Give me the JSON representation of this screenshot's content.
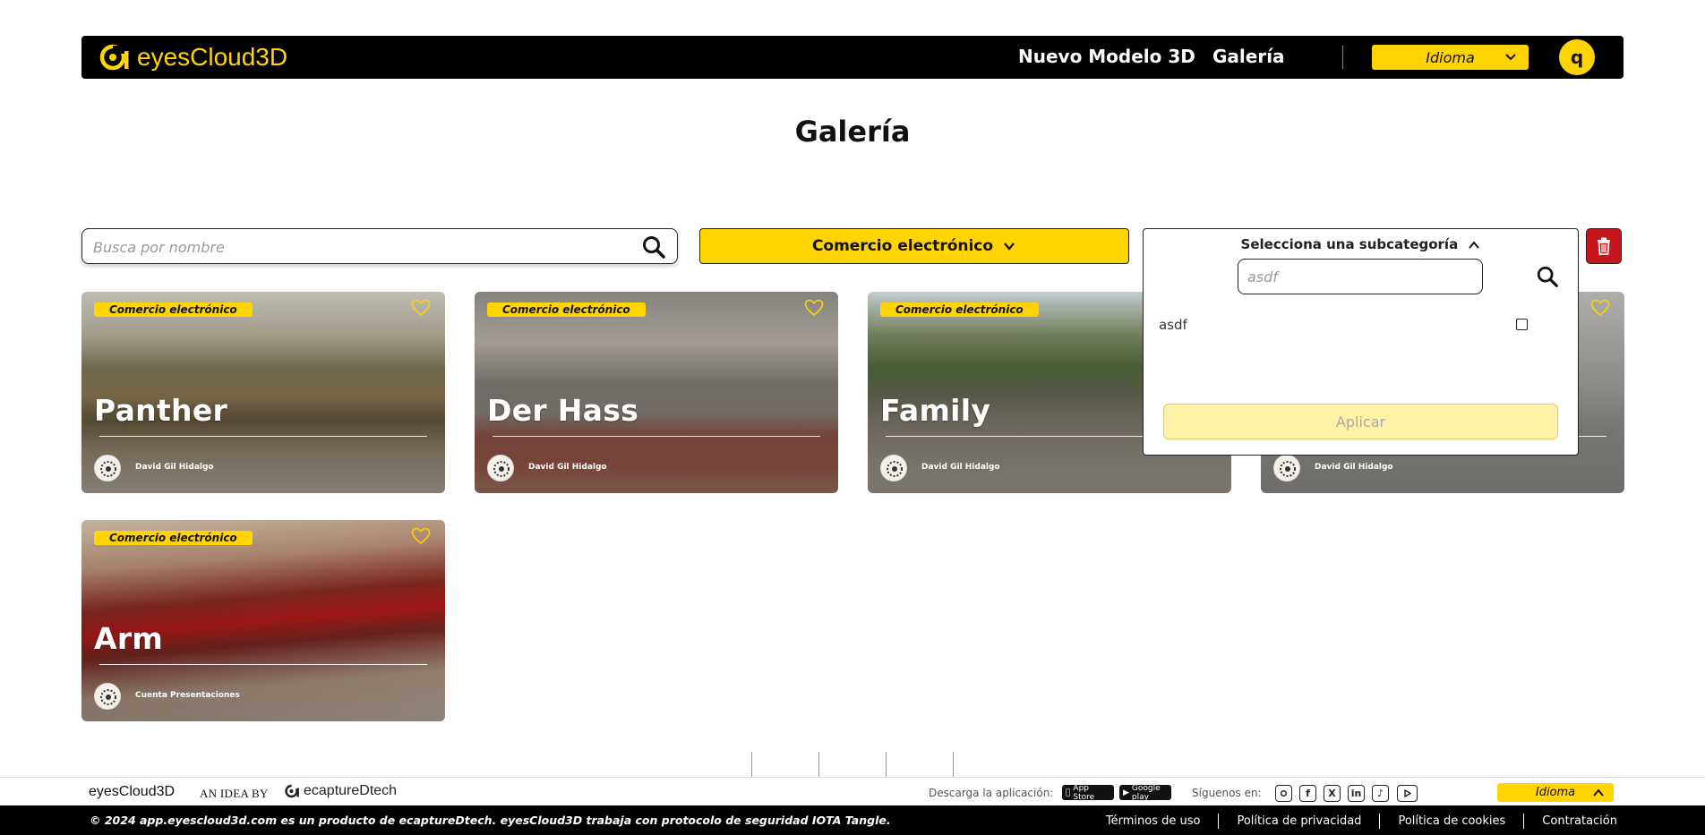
{
  "header": {
    "logo_text": "eyesCloud3D",
    "nav": {
      "new_model": "Nuevo Modelo 3D",
      "gallery": "Galería"
    },
    "language_label": "Idioma",
    "avatar_initial": "q"
  },
  "page_title": "Galería",
  "filters": {
    "search_placeholder": "Busca por nombre",
    "category_label": "Comercio electrónico",
    "subcategory": {
      "header": "Selecciona una subcategoría",
      "search_value": "asdf",
      "option_label": "asdf",
      "apply_label": "Aplicar"
    }
  },
  "cards": [
    {
      "badge": "Comercio electrónico",
      "title": "Panther",
      "author": "David Gil Hidalgo"
    },
    {
      "badge": "Comercio electrónico",
      "title": "Der Hass",
      "author": "David Gil Hidalgo"
    },
    {
      "badge": "Comercio electrónico",
      "title": "Family",
      "author": "David Gil Hidalgo"
    },
    {
      "badge": "",
      "title": "",
      "author": "David Gil Hidalgo"
    },
    {
      "badge": "Comercio electrónico",
      "title": "Arm",
      "author": "Cuenta Presentaciones"
    }
  ],
  "footer": {
    "brand": "eyesCloud3D",
    "idea_by": "AN IDEA BY",
    "partner": "ecaptureDtech",
    "download_label": "Descarga la aplicación:",
    "app_store": "App Store",
    "google_play": "Google play",
    "follow_label": "Síguenos en:",
    "language_label": "Idioma",
    "copyright": "© 2024 app.eyescloud3d.com es un producto de ecaptureDtech. eyesCloud3D trabaja con protocolo de seguridad IOTA Tangle.",
    "links": [
      "Términos de uso",
      "Política de privacidad",
      "Política de cookies",
      "Contratación"
    ]
  },
  "colors": {
    "accent": "#ffd400",
    "dark": "#000000",
    "delete": "#c4161c"
  },
  "icons": [
    "search-icon",
    "chevron-down-icon",
    "chevron-up-icon",
    "trash-icon",
    "heart-icon",
    "instagram-icon",
    "facebook-icon",
    "x-icon",
    "linkedin-icon",
    "tiktok-icon",
    "youtube-icon"
  ]
}
